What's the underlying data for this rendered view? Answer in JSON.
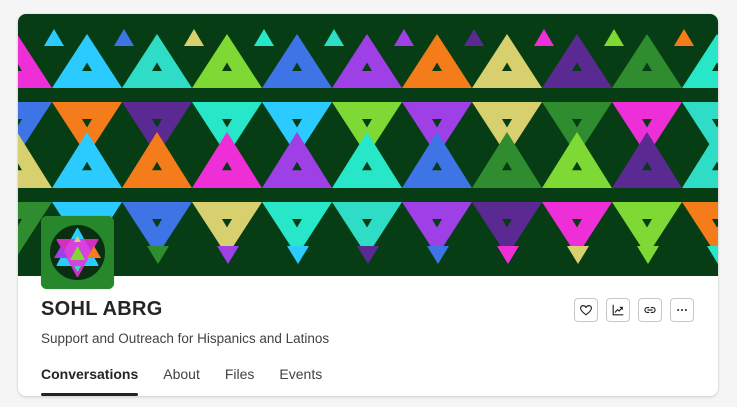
{
  "group": {
    "name": "SOHL ABRG",
    "description": "Support and Outreach for Hispanics and Latinos"
  },
  "banner": {
    "background": "#063d14",
    "palette": [
      "#ee2fd8",
      "#2ccbff",
      "#2fdcc6",
      "#7fd934",
      "#3f74e6",
      "#9f3fe6",
      "#f47c1a",
      "#d8cf6e",
      "#5a2a92",
      "#2f8c2f",
      "#28e6c8"
    ]
  },
  "actions": [
    {
      "name": "favorite-button",
      "icon": "heart-icon"
    },
    {
      "name": "analytics-button",
      "icon": "chart-icon"
    },
    {
      "name": "copy-link-button",
      "icon": "link-icon"
    },
    {
      "name": "more-options-button",
      "icon": "more-icon"
    }
  ],
  "tabs": [
    {
      "label": "Conversations",
      "active": true
    },
    {
      "label": "About",
      "active": false
    },
    {
      "label": "Files",
      "active": false
    },
    {
      "label": "Events",
      "active": false
    }
  ]
}
